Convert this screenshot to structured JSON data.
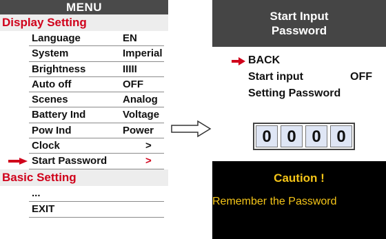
{
  "colors": {
    "header_bg": "#4a4a4a",
    "section_text": "#d0021b",
    "selector": "#d0021b",
    "caution_bg": "#000000",
    "caution_text": "#f5c518",
    "digit_bg": "#dfe6f5"
  },
  "menu": {
    "title": "MENU",
    "display_section": {
      "label": "Display Setting",
      "items": [
        {
          "label": "Language",
          "value": "EN"
        },
        {
          "label": "System",
          "value": "Imperial"
        },
        {
          "label": "Brightness",
          "value": "IIIII"
        },
        {
          "label": "Auto off",
          "value": "OFF"
        },
        {
          "label": "Scenes",
          "value": "Analog"
        },
        {
          "label": "Battery Ind",
          "value": "Voltage"
        },
        {
          "label": "Pow Ind",
          "value": "Power"
        },
        {
          "label": "Clock",
          "value": ">"
        },
        {
          "label": "Start Password",
          "value": ">"
        }
      ],
      "selected_index": 8
    },
    "basic_section": {
      "label": "Basic Setting",
      "items": [
        {
          "label": "..."
        },
        {
          "label": "EXIT"
        }
      ]
    }
  },
  "password_screen": {
    "title_line1": "Start Input",
    "title_line2": "Password",
    "back_label": "BACK",
    "start_input_label": "Start input",
    "start_input_value": "OFF",
    "setting_password_label": "Setting Password",
    "digits": [
      "0",
      "0",
      "0",
      "0"
    ],
    "caution_title": "Caution !",
    "caution_message": "Remember the Password"
  },
  "icons": {
    "selector": "right-arrow-icon",
    "flow": "flow-arrow-icon"
  }
}
